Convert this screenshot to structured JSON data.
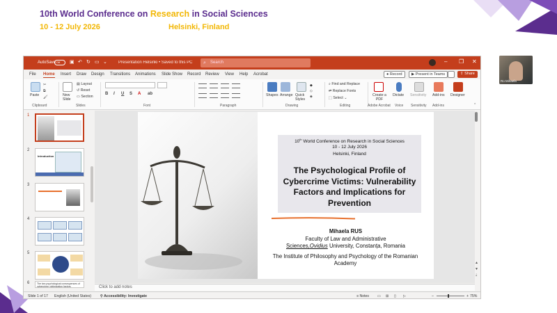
{
  "conference": {
    "title_part1": "10th World Conference on ",
    "title_highlight": "Research",
    "title_part2": " in Social Sciences",
    "dates": "10 - 12 July 2026",
    "place": "Helsinki, Finland",
    "accent_purple": "#5b2d8e",
    "accent_yellow": "#f2b705"
  },
  "webcam": {
    "name": "Ro Mihaela"
  },
  "ppt": {
    "titlebar": {
      "autosave": "AutoSave",
      "toggle": "Off",
      "filename": "Presentation Helsinki • Saved to this PC",
      "search_placeholder": "Search",
      "brand_color": "#c43e1c"
    },
    "menu": {
      "tabs": [
        "File",
        "Home",
        "Insert",
        "Draw",
        "Design",
        "Transitions",
        "Animations",
        "Slide Show",
        "Record",
        "Review",
        "View",
        "Help",
        "Acrobat"
      ],
      "record": "Record",
      "present_teams": "Present in Teams",
      "share": "Share"
    },
    "ribbon": {
      "paste": "Paste",
      "new_slide": "New Slide",
      "layout": "Layout",
      "reset": "Reset",
      "section": "Section",
      "find_replace": "Find and Replace",
      "replace_fonts": "Replace Fonts",
      "select": "Select",
      "shapes": "Shapes",
      "arrange": "Arrange",
      "quick_styles": "Quick Styles",
      "create_pdf": "Create a PDF",
      "dictate": "Dictate",
      "sensitivity": "Sensitivity",
      "addins": "Add-ins",
      "designer": "Designer",
      "groups": [
        "Clipboard",
        "Slides",
        "Font",
        "Paragraph",
        "Drawing",
        "Editing",
        "Adobe Acrobat",
        "Voice",
        "Sensitivity",
        "Add-ins"
      ]
    },
    "thumbnails": {
      "numbers": [
        "1",
        "2",
        "3",
        "4",
        "5",
        "6"
      ],
      "t2_title": "Introduction",
      "t6_text": "The two psychological consequences of cybercrime victimization factors"
    },
    "slide": {
      "conf_line1_sup": "th",
      "conf_line1_num": "10",
      "conf_line1_rest": " World Conference on Research in Social Sciences",
      "conf_line2": "10 - 12 July 2026",
      "conf_line3": "Helsinki, Finland",
      "title": "The Psychological Profile of Cybercrime Victims: Vulnerability Factors and Implications for Prevention",
      "author": "Mihaela RUS",
      "affil_line1": "Faculty of Law and Administrative",
      "affil_line2a": "Sciences,",
      "affil_line2_italic": "Ovidius",
      "affil_line2b": " University, Constanța, Romania",
      "affil2": "The Institute of Philosophy and Psychology of the Romanian Academy"
    },
    "notes": "Click to add notes",
    "status": {
      "slide_count": "Slide 1 of 17",
      "language": "English (United States)",
      "accessibility": "Accessibility: Investigate",
      "notes": "Notes",
      "zoom": "75%"
    }
  }
}
